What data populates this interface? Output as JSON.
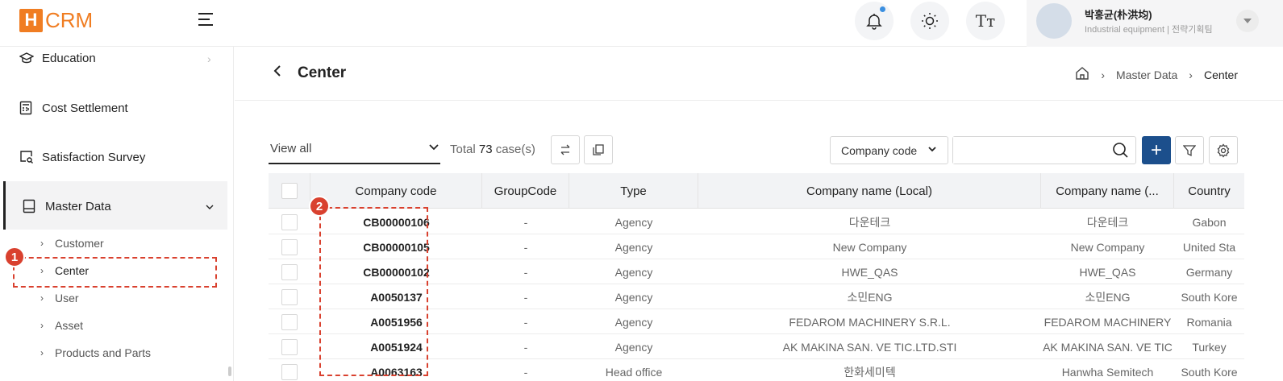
{
  "app": {
    "logo_letter": "H",
    "logo_text": "CRM"
  },
  "header": {
    "font_icon_label": "Tт",
    "user_name": "박홍균(朴洪均)",
    "user_dept": "Industrial equipment | 전략기획팀"
  },
  "sidebar": {
    "items": [
      {
        "label": "Education",
        "icon": "graduation-cap-icon"
      },
      {
        "label": "Cost Settlement",
        "icon": "calculator-icon"
      },
      {
        "label": "Satisfaction Survey",
        "icon": "survey-icon"
      },
      {
        "label": "Master Data",
        "icon": "master-data-icon"
      }
    ],
    "subitems": [
      "Customer",
      "Center",
      "User",
      "Asset",
      "Products and Parts"
    ],
    "active_subitem": "Center"
  },
  "annotations": {
    "badge1": "1",
    "badge2": "2",
    "color": "#d9412f"
  },
  "page": {
    "title": "Center",
    "breadcrumb": [
      "Master Data",
      "Center"
    ]
  },
  "toolbar": {
    "view_value": "View all",
    "total_prefix": "Total",
    "total_count": "73",
    "total_suffix": "case(s)",
    "search_type": "Company code",
    "search_placeholder": "",
    "add_label": "+"
  },
  "colors": {
    "brand": "#f07d22",
    "primary": "#1c4f8c",
    "notification": "#3b8fe0"
  },
  "table": {
    "columns": [
      "Company code",
      "GroupCode",
      "Type",
      "Company name (Local)",
      "Company name (...",
      "Country"
    ],
    "rows": [
      [
        "CB00000106",
        "-",
        "Agency",
        "다운테크",
        "다운테크",
        "Gabon"
      ],
      [
        "CB00000105",
        "-",
        "Agency",
        "New Company",
        "New Company",
        "United Sta"
      ],
      [
        "CB00000102",
        "-",
        "Agency",
        "HWE_QAS",
        "HWE_QAS",
        "Germany"
      ],
      [
        "A0050137",
        "-",
        "Agency",
        "소민ENG",
        "소민ENG",
        "South Kore"
      ],
      [
        "A0051956",
        "-",
        "Agency",
        "FEDAROM MACHINERY S.R.L.",
        "FEDAROM MACHINERY",
        "Romania"
      ],
      [
        "A0051924",
        "-",
        "Agency",
        "AK MAKINA SAN. VE TIC.LTD.STI",
        "AK MAKINA SAN. VE TIC",
        "Turkey"
      ],
      [
        "A0063163",
        "-",
        "Head office",
        "한화세미텍",
        "Hanwha Semitech",
        "South Kore"
      ]
    ]
  }
}
